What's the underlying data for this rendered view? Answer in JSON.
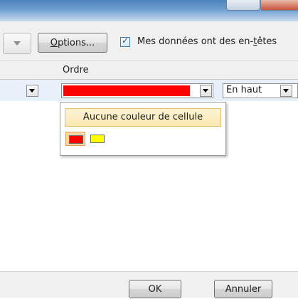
{
  "toolbar": {
    "options_label": "Options...",
    "options_label_pre": "",
    "options_label_accel": "O",
    "options_label_post": "ptions...",
    "checkbox_checked": true,
    "checkbox_label_pre": "Mes données ont des en-",
    "checkbox_label_accel": "t",
    "checkbox_label_post": "êtes"
  },
  "columns": {
    "order_header": "Ordre"
  },
  "row": {
    "color_value": "#ff0000",
    "order_value": "En haut"
  },
  "popup": {
    "no_color_label": "Aucune couleur de cellule",
    "swatches": [
      "#ff0000",
      "#ffff00"
    ],
    "selected_swatch": "#ff0000"
  },
  "footer": {
    "ok_label": "OK",
    "cancel_label": "Annuler"
  },
  "colors": {
    "title_bar": "#4f83bd",
    "dialog_bg": "#f0f0f0",
    "row_highlight": "#e8f1fa",
    "popup_hover": "#fbe8b1"
  }
}
